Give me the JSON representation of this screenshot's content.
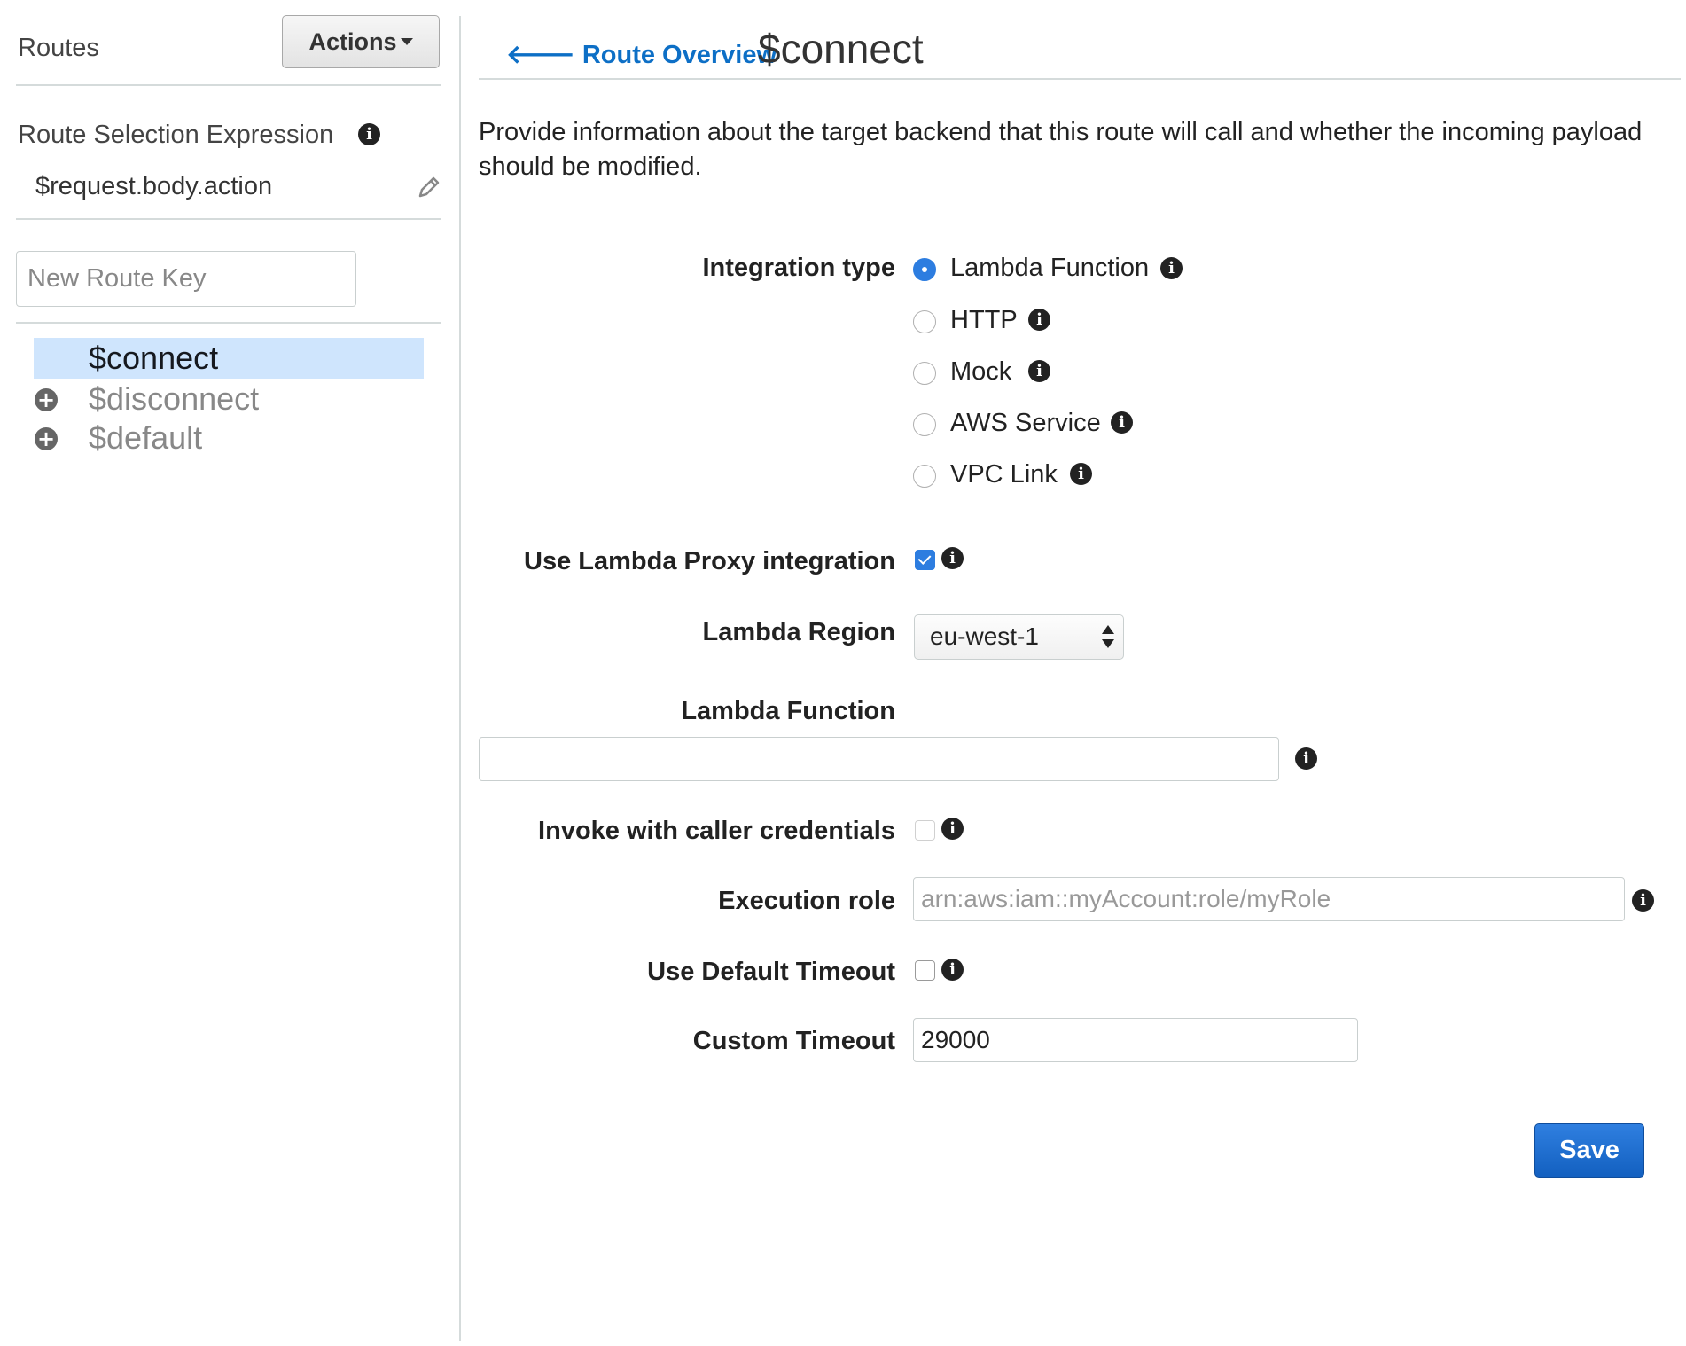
{
  "sidebar": {
    "title": "Routes",
    "actions_label": "Actions",
    "rse_label": "Route Selection Expression",
    "rse_value": "$request.body.action",
    "new_route_placeholder": "New Route Key",
    "routes": [
      {
        "label": "$connect",
        "selected": true
      },
      {
        "label": "$disconnect",
        "selected": false
      },
      {
        "label": "$default",
        "selected": false
      }
    ]
  },
  "header": {
    "back_link": "Route Overview",
    "title": "$connect"
  },
  "main": {
    "description": "Provide information about the target backend that this route will call and whether the incoming payload should be modified.",
    "integration_type": {
      "label": "Integration type",
      "options": [
        "Lambda Function",
        "HTTP",
        "Mock",
        "AWS Service",
        "VPC Link"
      ],
      "selected": "Lambda Function"
    },
    "proxy": {
      "label": "Use Lambda Proxy integration",
      "checked": true
    },
    "region": {
      "label": "Lambda Region",
      "value": "eu-west-1"
    },
    "lambda_function": {
      "label": "Lambda Function",
      "value": ""
    },
    "caller_credentials": {
      "label": "Invoke with caller credentials",
      "checked": false
    },
    "execution_role": {
      "label": "Execution role",
      "placeholder": "arn:aws:iam::myAccount:role/myRole"
    },
    "default_timeout": {
      "label": "Use Default Timeout",
      "checked": false
    },
    "custom_timeout": {
      "label": "Custom Timeout",
      "value": "29000"
    },
    "save_label": "Save"
  },
  "icons": {
    "info": "info-icon",
    "edit": "pencil-icon",
    "add": "plus-circle-icon",
    "back": "arrow-left-icon"
  }
}
